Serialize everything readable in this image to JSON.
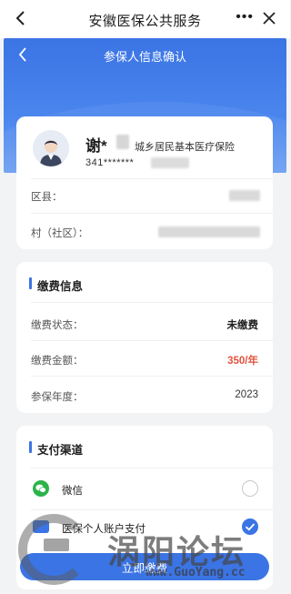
{
  "appbar": {
    "title": "安徽医保公共服务",
    "more_label": "•••",
    "back_icon": "chevron-left-icon",
    "close_icon": "close-icon"
  },
  "header": {
    "title": "参保人信息确认",
    "back_icon": "chevron-left-icon"
  },
  "profile": {
    "name_visible": "谢*",
    "insurance_type": "城乡居民基本医疗保险",
    "id_visible": "341*******"
  },
  "profile_rows": [
    {
      "label": "区县："
    },
    {
      "label": "村（社区）："
    }
  ],
  "payment_info": {
    "title": "缴费信息",
    "rows": [
      {
        "label": "缴费状态：",
        "value": "未缴费"
      },
      {
        "label": "缴费金额：",
        "value": "350/年"
      },
      {
        "label": "参保年度：",
        "value": "2023"
      }
    ]
  },
  "payment_channel": {
    "title": "支付渠道",
    "options": [
      {
        "label": "微信",
        "selected": false
      },
      {
        "label": "医保个人账户支付",
        "selected": true
      }
    ]
  },
  "pay_button": {
    "label": "立即缴费"
  },
  "watermark": {
    "text": "涡阳论坛",
    "url": "www.GuoYang.cc"
  },
  "colors": {
    "primary": "#3b74e4",
    "amount": "#e0533d",
    "wechat": "#2bb34a"
  }
}
